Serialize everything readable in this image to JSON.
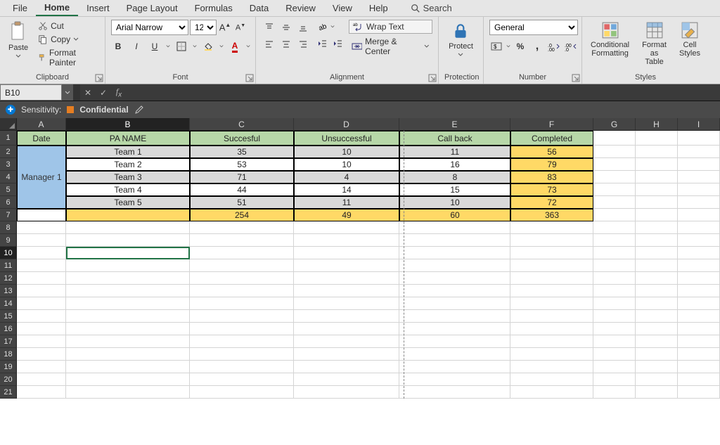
{
  "menubar": {
    "items": [
      "File",
      "Home",
      "Insert",
      "Page Layout",
      "Formulas",
      "Data",
      "Review",
      "View",
      "Help"
    ],
    "activeIndex": 1,
    "search": "Search"
  },
  "ribbon": {
    "clipboard": {
      "label": "Clipboard",
      "cut": "Cut",
      "copy": "Copy",
      "formatPainter": "Format Painter",
      "paste": "Paste"
    },
    "font": {
      "label": "Font",
      "name": "Arial Narrow",
      "size": "12"
    },
    "alignment": {
      "label": "Alignment",
      "wrap": "Wrap Text",
      "merge": "Merge & Center"
    },
    "protection": {
      "label": "Protection",
      "protect": "Protect"
    },
    "number": {
      "label": "Number",
      "format": "General"
    },
    "styles": {
      "label": "Styles",
      "cond": "Conditional\nFormatting",
      "table": "Format as\nTable",
      "cell": "Cell\nStyles"
    }
  },
  "namebox": "B10",
  "sensitivity": {
    "label": "Sensitivity:",
    "value": "Confidential"
  },
  "columns": [
    "A",
    "B",
    "C",
    "D",
    "E",
    "F",
    "G",
    "H",
    "I"
  ],
  "headers": {
    "A": "Date",
    "B": "PA NAME",
    "C": "Succesful",
    "D": "Unsuccessful",
    "E": "Call back",
    "F": "Completed"
  },
  "manager": "Manager 1",
  "teams": [
    {
      "name": "Team 1",
      "c": "35",
      "d": "10",
      "e": "11",
      "f": "56"
    },
    {
      "name": "Team 2",
      "c": "53",
      "d": "10",
      "e": "16",
      "f": "79"
    },
    {
      "name": "Team 3",
      "c": "71",
      "d": "4",
      "e": "8",
      "f": "83"
    },
    {
      "name": "Team 4",
      "c": "44",
      "d": "14",
      "e": "15",
      "f": "73"
    },
    {
      "name": "Team 5",
      "c": "51",
      "d": "11",
      "e": "10",
      "f": "72"
    }
  ],
  "totals": {
    "c": "254",
    "d": "49",
    "e": "60",
    "f": "363"
  },
  "chart_data": {
    "type": "table",
    "title": "",
    "columns": [
      "PA NAME",
      "Succesful",
      "Unsuccessful",
      "Call back",
      "Completed"
    ],
    "rows": [
      [
        "Team 1",
        35,
        10,
        11,
        56
      ],
      [
        "Team 2",
        53,
        10,
        16,
        79
      ],
      [
        "Team 3",
        71,
        4,
        8,
        83
      ],
      [
        "Team 4",
        44,
        14,
        15,
        73
      ],
      [
        "Team 5",
        51,
        11,
        10,
        72
      ]
    ],
    "totals": [
      254,
      49,
      60,
      363
    ]
  }
}
